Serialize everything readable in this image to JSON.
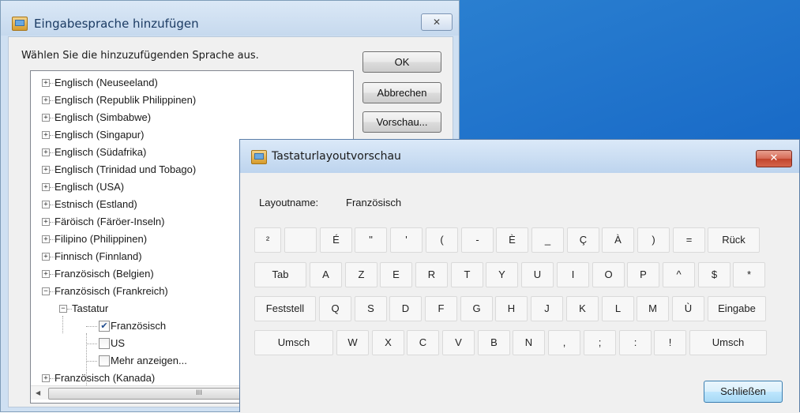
{
  "desktop": {
    "color": "#1a6cc8"
  },
  "add_language_dialog": {
    "title": "Eingabesprache hinzufügen",
    "close_glyph": "✕",
    "instruction": "Wählen Sie die hinzuzufügenden Sprache aus.",
    "buttons": {
      "ok": "OK",
      "cancel": "Abbrechen",
      "preview": "Vorschau..."
    },
    "tree": {
      "items": [
        {
          "label": "Englisch (Neuseeland)",
          "expander": "+"
        },
        {
          "label": "Englisch (Republik Philippinen)",
          "expander": "+"
        },
        {
          "label": "Englisch (Simbabwe)",
          "expander": "+"
        },
        {
          "label": "Englisch (Singapur)",
          "expander": "+"
        },
        {
          "label": "Englisch (Südafrika)",
          "expander": "+"
        },
        {
          "label": "Englisch (Trinidad und Tobago)",
          "expander": "+"
        },
        {
          "label": "Englisch (USA)",
          "expander": "+"
        },
        {
          "label": "Estnisch (Estland)",
          "expander": "+"
        },
        {
          "label": "Färöisch (Färöer-Inseln)",
          "expander": "+"
        },
        {
          "label": "Filipino (Philippinen)",
          "expander": "+"
        },
        {
          "label": "Finnisch (Finnland)",
          "expander": "+"
        },
        {
          "label": "Französisch (Belgien)",
          "expander": "+"
        },
        {
          "label": "Französisch (Frankreich)",
          "expander": "−"
        },
        {
          "label": "Tastatur",
          "expander": "−"
        },
        {
          "label": "Französisch",
          "checked": true
        },
        {
          "label": "US",
          "checked": false
        },
        {
          "label": "Mehr anzeigen...",
          "checked": false
        },
        {
          "label": "Französisch (Kanada)",
          "expander": "+"
        }
      ],
      "scrollbar": {
        "up": "▲",
        "left": "◀",
        "thumb_grip": "III"
      }
    }
  },
  "keyboard_preview_dialog": {
    "title": "Tastaturlayoutvorschau",
    "close_glyph": "✕",
    "layout_label": "Layoutname:",
    "layout_value": "Französisch",
    "rows": [
      [
        "²",
        "",
        "É",
        "\"",
        "'",
        "(",
        "-",
        "È",
        "_",
        "Ç",
        "À",
        ")",
        "=",
        "Rück"
      ],
      [
        "Tab",
        "A",
        "Z",
        "E",
        "R",
        "T",
        "Y",
        "U",
        "I",
        "O",
        "P",
        "^",
        "$",
        "*"
      ],
      [
        "Feststell",
        "Q",
        "S",
        "D",
        "F",
        "G",
        "H",
        "J",
        "K",
        "L",
        "M",
        "Ù",
        "Eingabe"
      ],
      [
        "Umsch",
        "W",
        "X",
        "C",
        "V",
        "B",
        "N",
        ",",
        ";",
        ":",
        "!",
        "Umsch"
      ]
    ],
    "close_button": "Schließen"
  }
}
